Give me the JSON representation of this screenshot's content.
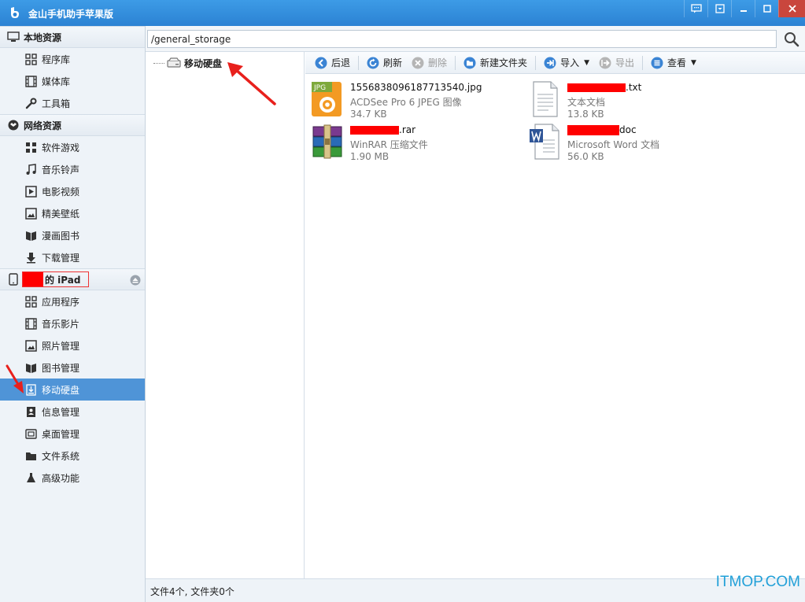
{
  "app": {
    "title": "金山手机助手苹果版"
  },
  "window_buttons": [
    {
      "name": "feedback-icon"
    },
    {
      "name": "menu-icon"
    },
    {
      "name": "minimize-icon"
    },
    {
      "name": "maximize-icon"
    },
    {
      "name": "close-icon"
    }
  ],
  "sidebar": {
    "local": {
      "title": "本地资源",
      "items": [
        {
          "label": "程序库",
          "icon": "grid-icon"
        },
        {
          "label": "媒体库",
          "icon": "film-icon"
        },
        {
          "label": "工具箱",
          "icon": "wrench-icon"
        }
      ]
    },
    "network": {
      "title": "网络资源",
      "items": [
        {
          "label": "软件游戏",
          "icon": "grid-icon"
        },
        {
          "label": "音乐铃声",
          "icon": "music-icon"
        },
        {
          "label": "电影视频",
          "icon": "video-icon"
        },
        {
          "label": "精美壁纸",
          "icon": "picture-icon"
        },
        {
          "label": "漫画图书",
          "icon": "book-icon"
        },
        {
          "label": "下载管理",
          "icon": "download-icon"
        }
      ]
    },
    "device": {
      "title_suffix": "的 iPad",
      "items": [
        {
          "label": "应用程序",
          "icon": "grid-icon"
        },
        {
          "label": "音乐影片",
          "icon": "film-icon"
        },
        {
          "label": "照片管理",
          "icon": "picture-icon"
        },
        {
          "label": "图书管理",
          "icon": "book-icon"
        },
        {
          "label": "移动硬盘",
          "icon": "drive-icon",
          "active": true
        },
        {
          "label": "信息管理",
          "icon": "contact-icon"
        },
        {
          "label": "桌面管理",
          "icon": "desktop-icon"
        },
        {
          "label": "文件系统",
          "icon": "folder-icon"
        },
        {
          "label": "高级功能",
          "icon": "flask-icon"
        }
      ]
    }
  },
  "address": {
    "value": "/general_storage"
  },
  "tree": {
    "root": "移动硬盘"
  },
  "toolbar": {
    "back": "后退",
    "refresh": "刷新",
    "delete": "删除",
    "new_folder": "新建文件夹",
    "import": "导入",
    "export": "导出",
    "view": "查看"
  },
  "files": [
    {
      "name": "1556838096187713540.jpg",
      "type": "ACDSee Pro 6 JPEG 图像",
      "size": "34.7 KB",
      "icon": "jpg-file-icon",
      "badge": "JPG"
    },
    {
      "name_suffix": ".txt",
      "type": "文本文档",
      "size": "13.8 KB",
      "icon": "txt-file-icon"
    },
    {
      "name_suffix": ".rar",
      "type": "WinRAR 压缩文件",
      "size": "1.90 MB",
      "icon": "rar-file-icon"
    },
    {
      "name_suffix": "doc",
      "type": "Microsoft Word 文档",
      "size": "56.0 KB",
      "icon": "word-file-icon"
    }
  ],
  "status": {
    "text": "文件4个, 文件夹0个"
  },
  "watermark": "ITMOP.COM",
  "colors": {
    "titlebar": "#2b82d3",
    "active_item": "#4f94d7",
    "annotation_arrow": "#e8201c",
    "redaction": "#ff0000"
  }
}
